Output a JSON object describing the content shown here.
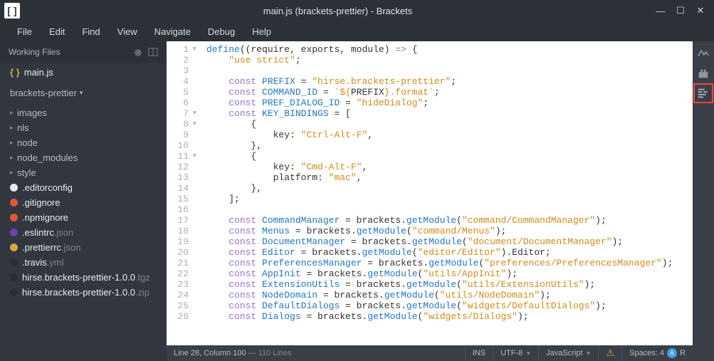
{
  "window": {
    "title": "main.js (brackets-prettier) - Brackets"
  },
  "menu": [
    "File",
    "Edit",
    "Find",
    "View",
    "Navigate",
    "Debug",
    "Help"
  ],
  "workingFiles": {
    "label": "Working Files",
    "items": [
      {
        "name": "main.js",
        "icon": "brace"
      }
    ]
  },
  "project": {
    "name": "brackets-prettier",
    "tree": [
      {
        "type": "folder",
        "name": "images"
      },
      {
        "type": "folder",
        "name": "nls"
      },
      {
        "type": "folder",
        "name": "node"
      },
      {
        "type": "folder",
        "name": "node_modules"
      },
      {
        "type": "folder",
        "name": "style"
      },
      {
        "type": "file",
        "name": ".editorconfig",
        "ext": "",
        "dot": "#e8e8e8"
      },
      {
        "type": "file",
        "name": ".gitignore",
        "ext": "",
        "dot": "#e25438"
      },
      {
        "type": "file",
        "name": ".npmignore",
        "ext": "",
        "dot": "#e25438"
      },
      {
        "type": "file",
        "name": ".eslintrc",
        "ext": ".json",
        "dot": "#6c3fb5"
      },
      {
        "type": "file",
        "name": ".prettierrc",
        "ext": ".json",
        "dot": "#d8a93e"
      },
      {
        "type": "file",
        "name": ".travis",
        "ext": ".yml",
        "dot": "#2d2d2d"
      },
      {
        "type": "file",
        "name": "hirse.brackets-prettier-1.0.0",
        "ext": ".tgz",
        "dot": "#2d2d2d"
      },
      {
        "type": "file",
        "name": "hirse.brackets-prettier-1.0.0",
        "ext": ".zip",
        "dot": "#2d2d2d"
      }
    ]
  },
  "editor": {
    "lines": [
      {
        "n": 1,
        "fold": true,
        "tokens": [
          [
            "def",
            "define"
          ],
          [
            "punc",
            "(("
          ],
          [
            "ident",
            "require"
          ],
          [
            "punc",
            ", "
          ],
          [
            "ident",
            "exports"
          ],
          [
            "punc",
            ", "
          ],
          [
            "ident",
            "module"
          ],
          [
            "punc",
            ") "
          ],
          [
            "kw",
            "=>"
          ],
          [
            "punc",
            " {"
          ]
        ]
      },
      {
        "n": 2,
        "indent": 2,
        "tokens": [
          [
            "str",
            "\"use strict\""
          ],
          [
            "punc",
            ";"
          ]
        ]
      },
      {
        "n": 3,
        "tokens": []
      },
      {
        "n": 4,
        "indent": 2,
        "tokens": [
          [
            "kw",
            "const "
          ],
          [
            "def",
            "PREFIX"
          ],
          [
            "punc",
            " = "
          ],
          [
            "str",
            "\"hirse.brackets-prettier\""
          ],
          [
            "punc",
            ";"
          ]
        ]
      },
      {
        "n": 5,
        "indent": 2,
        "tokens": [
          [
            "kw",
            "const "
          ],
          [
            "def",
            "COMMAND_ID"
          ],
          [
            "punc",
            " = "
          ],
          [
            "str",
            "`${"
          ],
          [
            "ident",
            "PREFIX"
          ],
          [
            "str",
            "}.format`"
          ],
          [
            "punc",
            ";"
          ]
        ]
      },
      {
        "n": 6,
        "indent": 2,
        "tokens": [
          [
            "kw",
            "const "
          ],
          [
            "def",
            "PREF_DIALOG_ID"
          ],
          [
            "punc",
            " = "
          ],
          [
            "str",
            "\"hideDialog\""
          ],
          [
            "punc",
            ";"
          ]
        ]
      },
      {
        "n": 7,
        "fold": true,
        "indent": 2,
        "tokens": [
          [
            "kw",
            "const "
          ],
          [
            "def",
            "KEY_BINDINGS"
          ],
          [
            "punc",
            " = ["
          ]
        ]
      },
      {
        "n": 8,
        "fold": true,
        "indent": 4,
        "tokens": [
          [
            "punc",
            "{"
          ]
        ]
      },
      {
        "n": 9,
        "indent": 6,
        "tokens": [
          [
            "prop",
            "key"
          ],
          [
            "punc",
            ": "
          ],
          [
            "str",
            "\"Ctrl-Alt-F\""
          ],
          [
            "punc",
            ","
          ]
        ]
      },
      {
        "n": 10,
        "indent": 4,
        "tokens": [
          [
            "punc",
            "},"
          ]
        ]
      },
      {
        "n": 11,
        "fold": true,
        "indent": 4,
        "tokens": [
          [
            "punc",
            "{"
          ]
        ]
      },
      {
        "n": 12,
        "indent": 6,
        "tokens": [
          [
            "prop",
            "key"
          ],
          [
            "punc",
            ": "
          ],
          [
            "str",
            "\"Cmd-Alt-F\""
          ],
          [
            "punc",
            ","
          ]
        ]
      },
      {
        "n": 13,
        "indent": 6,
        "tokens": [
          [
            "prop",
            "platform"
          ],
          [
            "punc",
            ": "
          ],
          [
            "str",
            "\"mac\""
          ],
          [
            "punc",
            ","
          ]
        ]
      },
      {
        "n": 14,
        "indent": 4,
        "tokens": [
          [
            "punc",
            "},"
          ]
        ]
      },
      {
        "n": 15,
        "indent": 2,
        "tokens": [
          [
            "punc",
            "];"
          ]
        ]
      },
      {
        "n": 16,
        "tokens": []
      },
      {
        "n": 17,
        "indent": 2,
        "tokens": [
          [
            "kw",
            "const "
          ],
          [
            "def",
            "CommandManager"
          ],
          [
            "punc",
            " = "
          ],
          [
            "ident",
            "brackets"
          ],
          [
            "punc",
            "."
          ],
          [
            "meth",
            "getModule"
          ],
          [
            "punc",
            "("
          ],
          [
            "str",
            "\"command/CommandManager\""
          ],
          [
            "punc",
            ");"
          ]
        ]
      },
      {
        "n": 18,
        "indent": 2,
        "tokens": [
          [
            "kw",
            "const "
          ],
          [
            "def",
            "Menus"
          ],
          [
            "punc",
            " = "
          ],
          [
            "ident",
            "brackets"
          ],
          [
            "punc",
            "."
          ],
          [
            "meth",
            "getModule"
          ],
          [
            "punc",
            "("
          ],
          [
            "str",
            "\"command/Menus\""
          ],
          [
            "punc",
            ");"
          ]
        ]
      },
      {
        "n": 19,
        "indent": 2,
        "tokens": [
          [
            "kw",
            "const "
          ],
          [
            "def",
            "DocumentManager"
          ],
          [
            "punc",
            " = "
          ],
          [
            "ident",
            "brackets"
          ],
          [
            "punc",
            "."
          ],
          [
            "meth",
            "getModule"
          ],
          [
            "punc",
            "("
          ],
          [
            "str",
            "\"document/DocumentManager\""
          ],
          [
            "punc",
            ");"
          ]
        ]
      },
      {
        "n": 20,
        "indent": 2,
        "tokens": [
          [
            "kw",
            "const "
          ],
          [
            "def",
            "Editor"
          ],
          [
            "punc",
            " = "
          ],
          [
            "ident",
            "brackets"
          ],
          [
            "punc",
            "."
          ],
          [
            "meth",
            "getModule"
          ],
          [
            "punc",
            "("
          ],
          [
            "str",
            "\"editor/Editor\""
          ],
          [
            "punc",
            ")."
          ],
          [
            "ident",
            "Editor"
          ],
          [
            "punc",
            ";"
          ]
        ]
      },
      {
        "n": 21,
        "indent": 2,
        "tokens": [
          [
            "kw",
            "const "
          ],
          [
            "def",
            "PreferencesManager"
          ],
          [
            "punc",
            " = "
          ],
          [
            "ident",
            "brackets"
          ],
          [
            "punc",
            "."
          ],
          [
            "meth",
            "getModule"
          ],
          [
            "punc",
            "("
          ],
          [
            "str",
            "\"preferences/PreferencesManager\""
          ],
          [
            "punc",
            ");"
          ]
        ]
      },
      {
        "n": 22,
        "indent": 2,
        "tokens": [
          [
            "kw",
            "const "
          ],
          [
            "def",
            "AppInit"
          ],
          [
            "punc",
            " = "
          ],
          [
            "ident",
            "brackets"
          ],
          [
            "punc",
            "."
          ],
          [
            "meth",
            "getModule"
          ],
          [
            "punc",
            "("
          ],
          [
            "str",
            "\"utils/AppInit\""
          ],
          [
            "punc",
            ");"
          ]
        ]
      },
      {
        "n": 23,
        "indent": 2,
        "tokens": [
          [
            "kw",
            "const "
          ],
          [
            "def",
            "ExtensionUtils"
          ],
          [
            "punc",
            " = "
          ],
          [
            "ident",
            "brackets"
          ],
          [
            "punc",
            "."
          ],
          [
            "meth",
            "getModule"
          ],
          [
            "punc",
            "("
          ],
          [
            "str",
            "\"utils/ExtensionUtils\""
          ],
          [
            "punc",
            ");"
          ]
        ]
      },
      {
        "n": 24,
        "indent": 2,
        "tokens": [
          [
            "kw",
            "const "
          ],
          [
            "def",
            "NodeDomain"
          ],
          [
            "punc",
            " = "
          ],
          [
            "ident",
            "brackets"
          ],
          [
            "punc",
            "."
          ],
          [
            "meth",
            "getModule"
          ],
          [
            "punc",
            "("
          ],
          [
            "str",
            "\"utils/NodeDomain\""
          ],
          [
            "punc",
            ");"
          ]
        ]
      },
      {
        "n": 25,
        "indent": 2,
        "tokens": [
          [
            "kw",
            "const "
          ],
          [
            "def",
            "DefaultDialogs"
          ],
          [
            "punc",
            " = "
          ],
          [
            "ident",
            "brackets"
          ],
          [
            "punc",
            "."
          ],
          [
            "meth",
            "getModule"
          ],
          [
            "punc",
            "("
          ],
          [
            "str",
            "\"widgets/DefaultDialogs\""
          ],
          [
            "punc",
            ");"
          ]
        ]
      },
      {
        "n": 26,
        "indent": 2,
        "tokens": [
          [
            "kw",
            "const "
          ],
          [
            "def",
            "Dialogs"
          ],
          [
            "punc",
            " = "
          ],
          [
            "ident",
            "brackets"
          ],
          [
            "punc",
            "."
          ],
          [
            "meth",
            "getModule"
          ],
          [
            "punc",
            "("
          ],
          [
            "str",
            "\"widgets/Dialogs\""
          ],
          [
            "punc",
            ");"
          ]
        ]
      }
    ]
  },
  "statusbar": {
    "cursor": "Line 28, Column 100",
    "lineCount": "110 Lines",
    "insert": "INS",
    "encoding": "UTF-8",
    "language": "JavaScript",
    "spacesLabel": "Spaces:",
    "spaces": "4",
    "readonly": "R"
  }
}
